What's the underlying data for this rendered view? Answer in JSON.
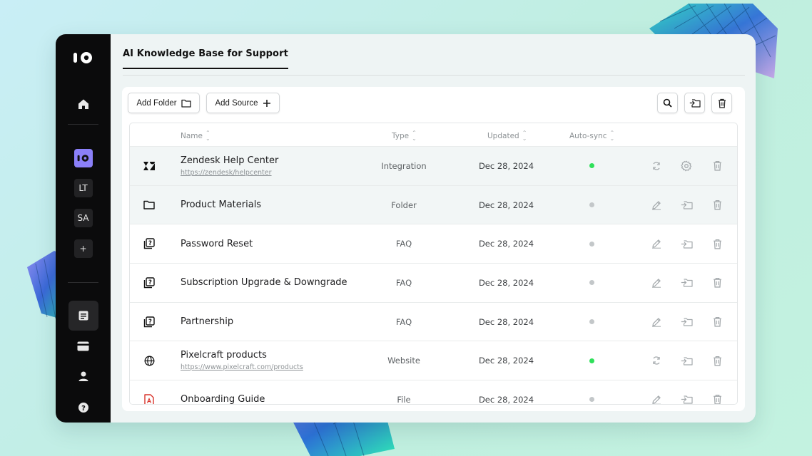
{
  "app": {
    "title": "AI Knowledge Base for Support"
  },
  "sidebar": {
    "workspaces": [
      "LT",
      "SA"
    ],
    "add_label": "+"
  },
  "toolbar": {
    "add_folder": "Add Folder",
    "add_source": "Add Source"
  },
  "table": {
    "headers": {
      "name": "Name",
      "type": "Type",
      "updated": "Updated",
      "sync": "Auto-sync"
    },
    "rows": [
      {
        "icon": "zendesk-icon",
        "name": "Zendesk Help Center",
        "url": "https://zendesk/helpcenter",
        "type": "Integration",
        "updated": "Dec 28, 2024",
        "sync": true
      },
      {
        "icon": "folder-icon",
        "name": "Product Materials",
        "url": "",
        "type": "Folder",
        "updated": "Dec 28, 2024",
        "sync": false
      },
      {
        "icon": "faq-icon",
        "name": "Password Reset",
        "url": "",
        "type": "FAQ",
        "updated": "Dec 28, 2024",
        "sync": false
      },
      {
        "icon": "faq-icon",
        "name": "Subscription Upgrade & Downgrade",
        "url": "",
        "type": "FAQ",
        "updated": "Dec 28, 2024",
        "sync": false
      },
      {
        "icon": "faq-icon",
        "name": "Partnership",
        "url": "",
        "type": "FAQ",
        "updated": "Dec 28, 2024",
        "sync": false
      },
      {
        "icon": "globe-icon",
        "name": "Pixelcraft products",
        "url": "https://www.pixelcraft.com/products",
        "type": "Website",
        "updated": "Dec 28, 2024",
        "sync": true
      },
      {
        "icon": "pdf-file-icon",
        "name": "Onboarding Guide",
        "url": "",
        "type": "File",
        "updated": "Dec 28, 2024",
        "sync": false
      }
    ]
  },
  "colors": {
    "accent": "#8b80f9",
    "sync_on": "#2fe05a",
    "sync_off": "#c3c7c9",
    "pdf": "#d9342b"
  }
}
